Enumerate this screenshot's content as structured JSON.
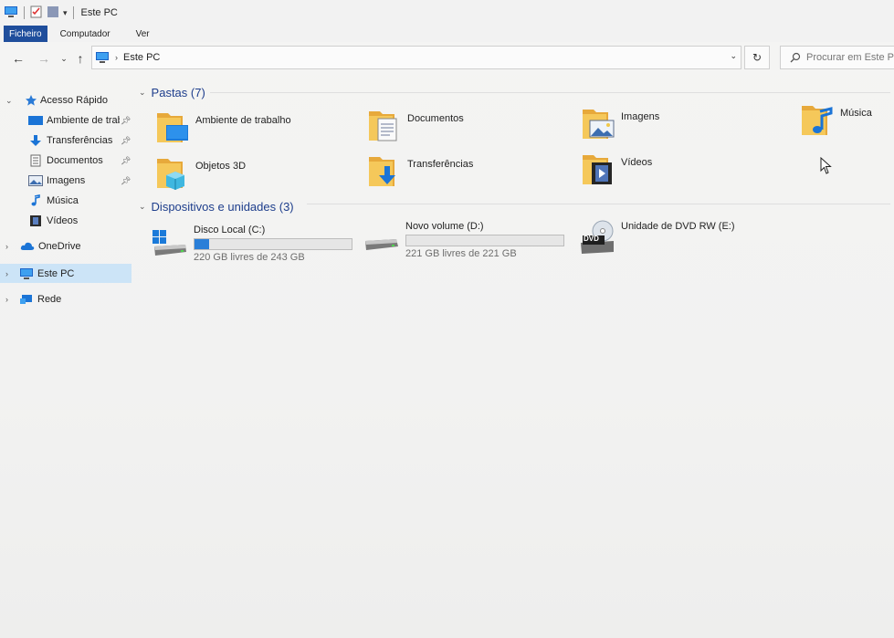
{
  "window": {
    "title": "Este PC"
  },
  "ribbon": {
    "tabs": [
      {
        "label": "Ficheiro"
      },
      {
        "label": "Computador"
      },
      {
        "label": "Ver"
      }
    ]
  },
  "address": {
    "path": "Este PC",
    "search_placeholder": "Procurar em Este PC"
  },
  "sidebar": {
    "items": [
      {
        "label": "Acesso Rápido",
        "icon": "star-icon"
      },
      {
        "label": "Ambiente de trabalho",
        "icon": "desktop-icon",
        "pinned": true
      },
      {
        "label": "Transferências",
        "icon": "download-icon",
        "pinned": true
      },
      {
        "label": "Documentos",
        "icon": "documents-icon",
        "pinned": true
      },
      {
        "label": "Imagens",
        "icon": "pictures-icon",
        "pinned": true
      },
      {
        "label": "Música",
        "icon": "music-icon"
      },
      {
        "label": "Vídeos",
        "icon": "videos-icon"
      },
      {
        "label": "OneDrive",
        "icon": "cloud-icon"
      },
      {
        "label": "Este PC",
        "icon": "computer-icon",
        "selected": true
      },
      {
        "label": "Rede",
        "icon": "network-icon"
      }
    ]
  },
  "folders_group": {
    "title": "Pastas (7)",
    "items": [
      {
        "label": "Ambiente de trabalho",
        "icon": "desktop-folder-icon"
      },
      {
        "label": "Documentos",
        "icon": "documents-folder-icon"
      },
      {
        "label": "Imagens",
        "icon": "pictures-folder-icon"
      },
      {
        "label": "Música",
        "icon": "music-folder-icon"
      },
      {
        "label": "Objetos 3D",
        "icon": "objects-3d-folder-icon"
      },
      {
        "label": "Transferências",
        "icon": "downloads-folder-icon"
      },
      {
        "label": "Vídeos",
        "icon": "videos-folder-icon"
      }
    ]
  },
  "drives_group": {
    "title": "Dispositivos e unidades (3)",
    "items": [
      {
        "label": "Disco Local (C:)",
        "free": "220 GB livres de 243 GB",
        "used_fraction": 0.095,
        "icon": "system-drive-icon"
      },
      {
        "label": "Novo volume (D:)",
        "free": "221 GB livres de 221 GB",
        "used_fraction": 0.0,
        "icon": "drive-icon"
      },
      {
        "label": "Unidade de DVD RW (E:)",
        "icon": "dvd-drive-icon",
        "dvd_text": "DVD"
      }
    ]
  },
  "colors": {
    "accent": "#1f4e9c",
    "selection": "#cce4f7",
    "group_header": "#1e3e8c",
    "folder": "#f2c04b",
    "progress": "#2a7fd8"
  }
}
